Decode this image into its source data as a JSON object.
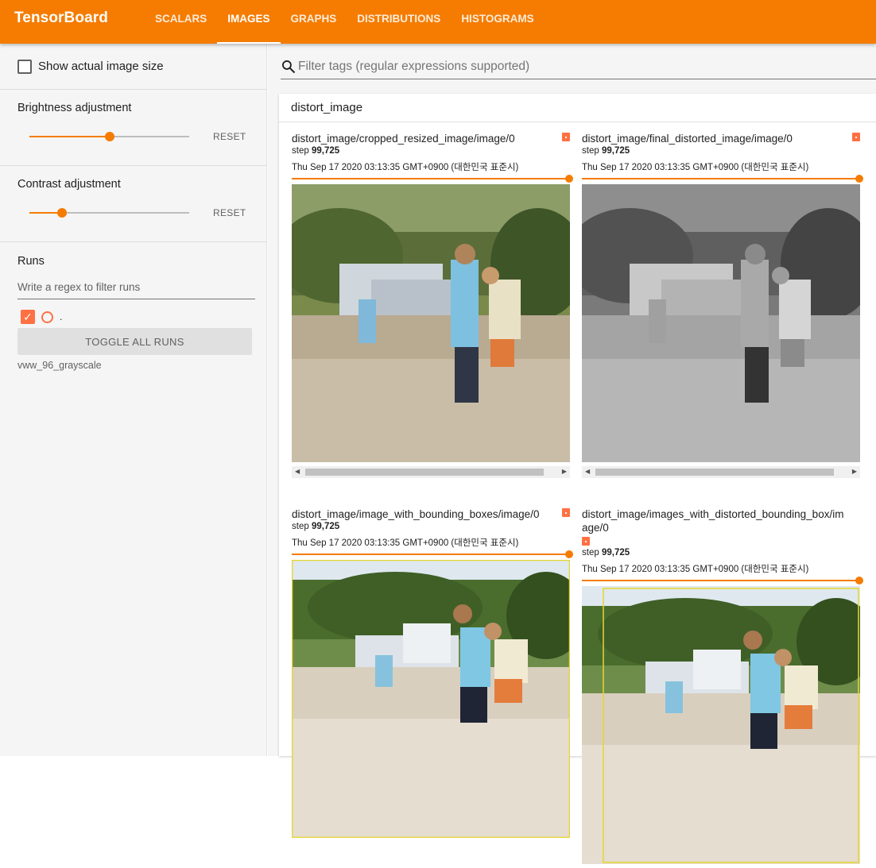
{
  "app": {
    "title": "TensorBoard"
  },
  "nav": {
    "tabs": [
      "SCALARS",
      "IMAGES",
      "GRAPHS",
      "DISTRIBUTIONS",
      "HISTOGRAMS"
    ],
    "active": "IMAGES"
  },
  "sidebar": {
    "show_actual_size_label": "Show actual image size",
    "brightness": {
      "title": "Brightness adjustment",
      "reset": "RESET",
      "level": 0.5
    },
    "contrast": {
      "title": "Contrast adjustment",
      "reset": "RESET",
      "level": 0.2
    },
    "runs": {
      "title": "Runs",
      "filter_placeholder": "Write a regex to filter runs",
      "run_label": ".",
      "toggle_all": "TOGGLE ALL RUNS",
      "run_name": "vww_96_grayscale"
    }
  },
  "main": {
    "filter_placeholder": "Filter tags (regular expressions supported)",
    "group_title": "distort_image",
    "step_prefix": "step",
    "cards": [
      {
        "tag": "distort_image/cropped_resized_image/image/0",
        "step": "99,725",
        "date": "Thu Sep 17 2020 03:13:35 GMT+0900 (대한민국 표준시)"
      },
      {
        "tag": "distort_image/final_distorted_image/image/0",
        "step": "99,725",
        "date": "Thu Sep 17 2020 03:13:35 GMT+0900 (대한민국 표준시)"
      },
      {
        "tag": "distort_image/image_with_bounding_boxes/image/0",
        "step": "99,725",
        "date": "Thu Sep 17 2020 03:13:35 GMT+0900 (대한민국 표준시)"
      },
      {
        "tag": "distort_image/images_with_distorted_bounding_box/image/0",
        "step": "99,725",
        "date": "Thu Sep 17 2020 03:13:35 GMT+0900 (대한민국 표준시)"
      }
    ]
  },
  "colors": {
    "accent": "#f57c00",
    "run": "#ff7043"
  },
  "icons": {
    "search": "search-icon",
    "checkbox": "checkbox-icon",
    "run_color": "run-color-icon"
  }
}
